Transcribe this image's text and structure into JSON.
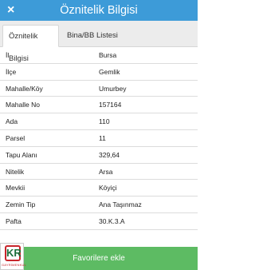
{
  "header": {
    "title": "Öznitelik Bilgisi",
    "close_glyph": "×"
  },
  "tabs": [
    {
      "label": "Öznitelik Bilgisi",
      "active": true
    },
    {
      "label": "Bina/BB Listesi",
      "active": false
    }
  ],
  "rows": [
    {
      "key": "İl",
      "value": "Bursa"
    },
    {
      "key": "İlçe",
      "value": "Gemlik"
    },
    {
      "key": "Mahalle/Köy",
      "value": "Umurbey"
    },
    {
      "key": "Mahalle No",
      "value": "157164"
    },
    {
      "key": "Ada",
      "value": "110"
    },
    {
      "key": "Parsel",
      "value": "11"
    },
    {
      "key": "Tapu Alanı",
      "value": "329,64"
    },
    {
      "key": "Nitelik",
      "value": "Arsa"
    },
    {
      "key": "Mevkii",
      "value": "Köyiçi"
    },
    {
      "key": "Zemin Tip",
      "value": "Ana Taşınmaz"
    },
    {
      "key": "Pafta",
      "value": "30.K.3.A"
    }
  ],
  "footer": {
    "favorite_label": "Favorilere ekle"
  },
  "logo": {
    "mark": "KR",
    "text": "GAYRİMENKUL"
  },
  "colors": {
    "header": "#3d9bd8",
    "footer": "#5dbb63",
    "logo_accent": "#c8262c"
  }
}
